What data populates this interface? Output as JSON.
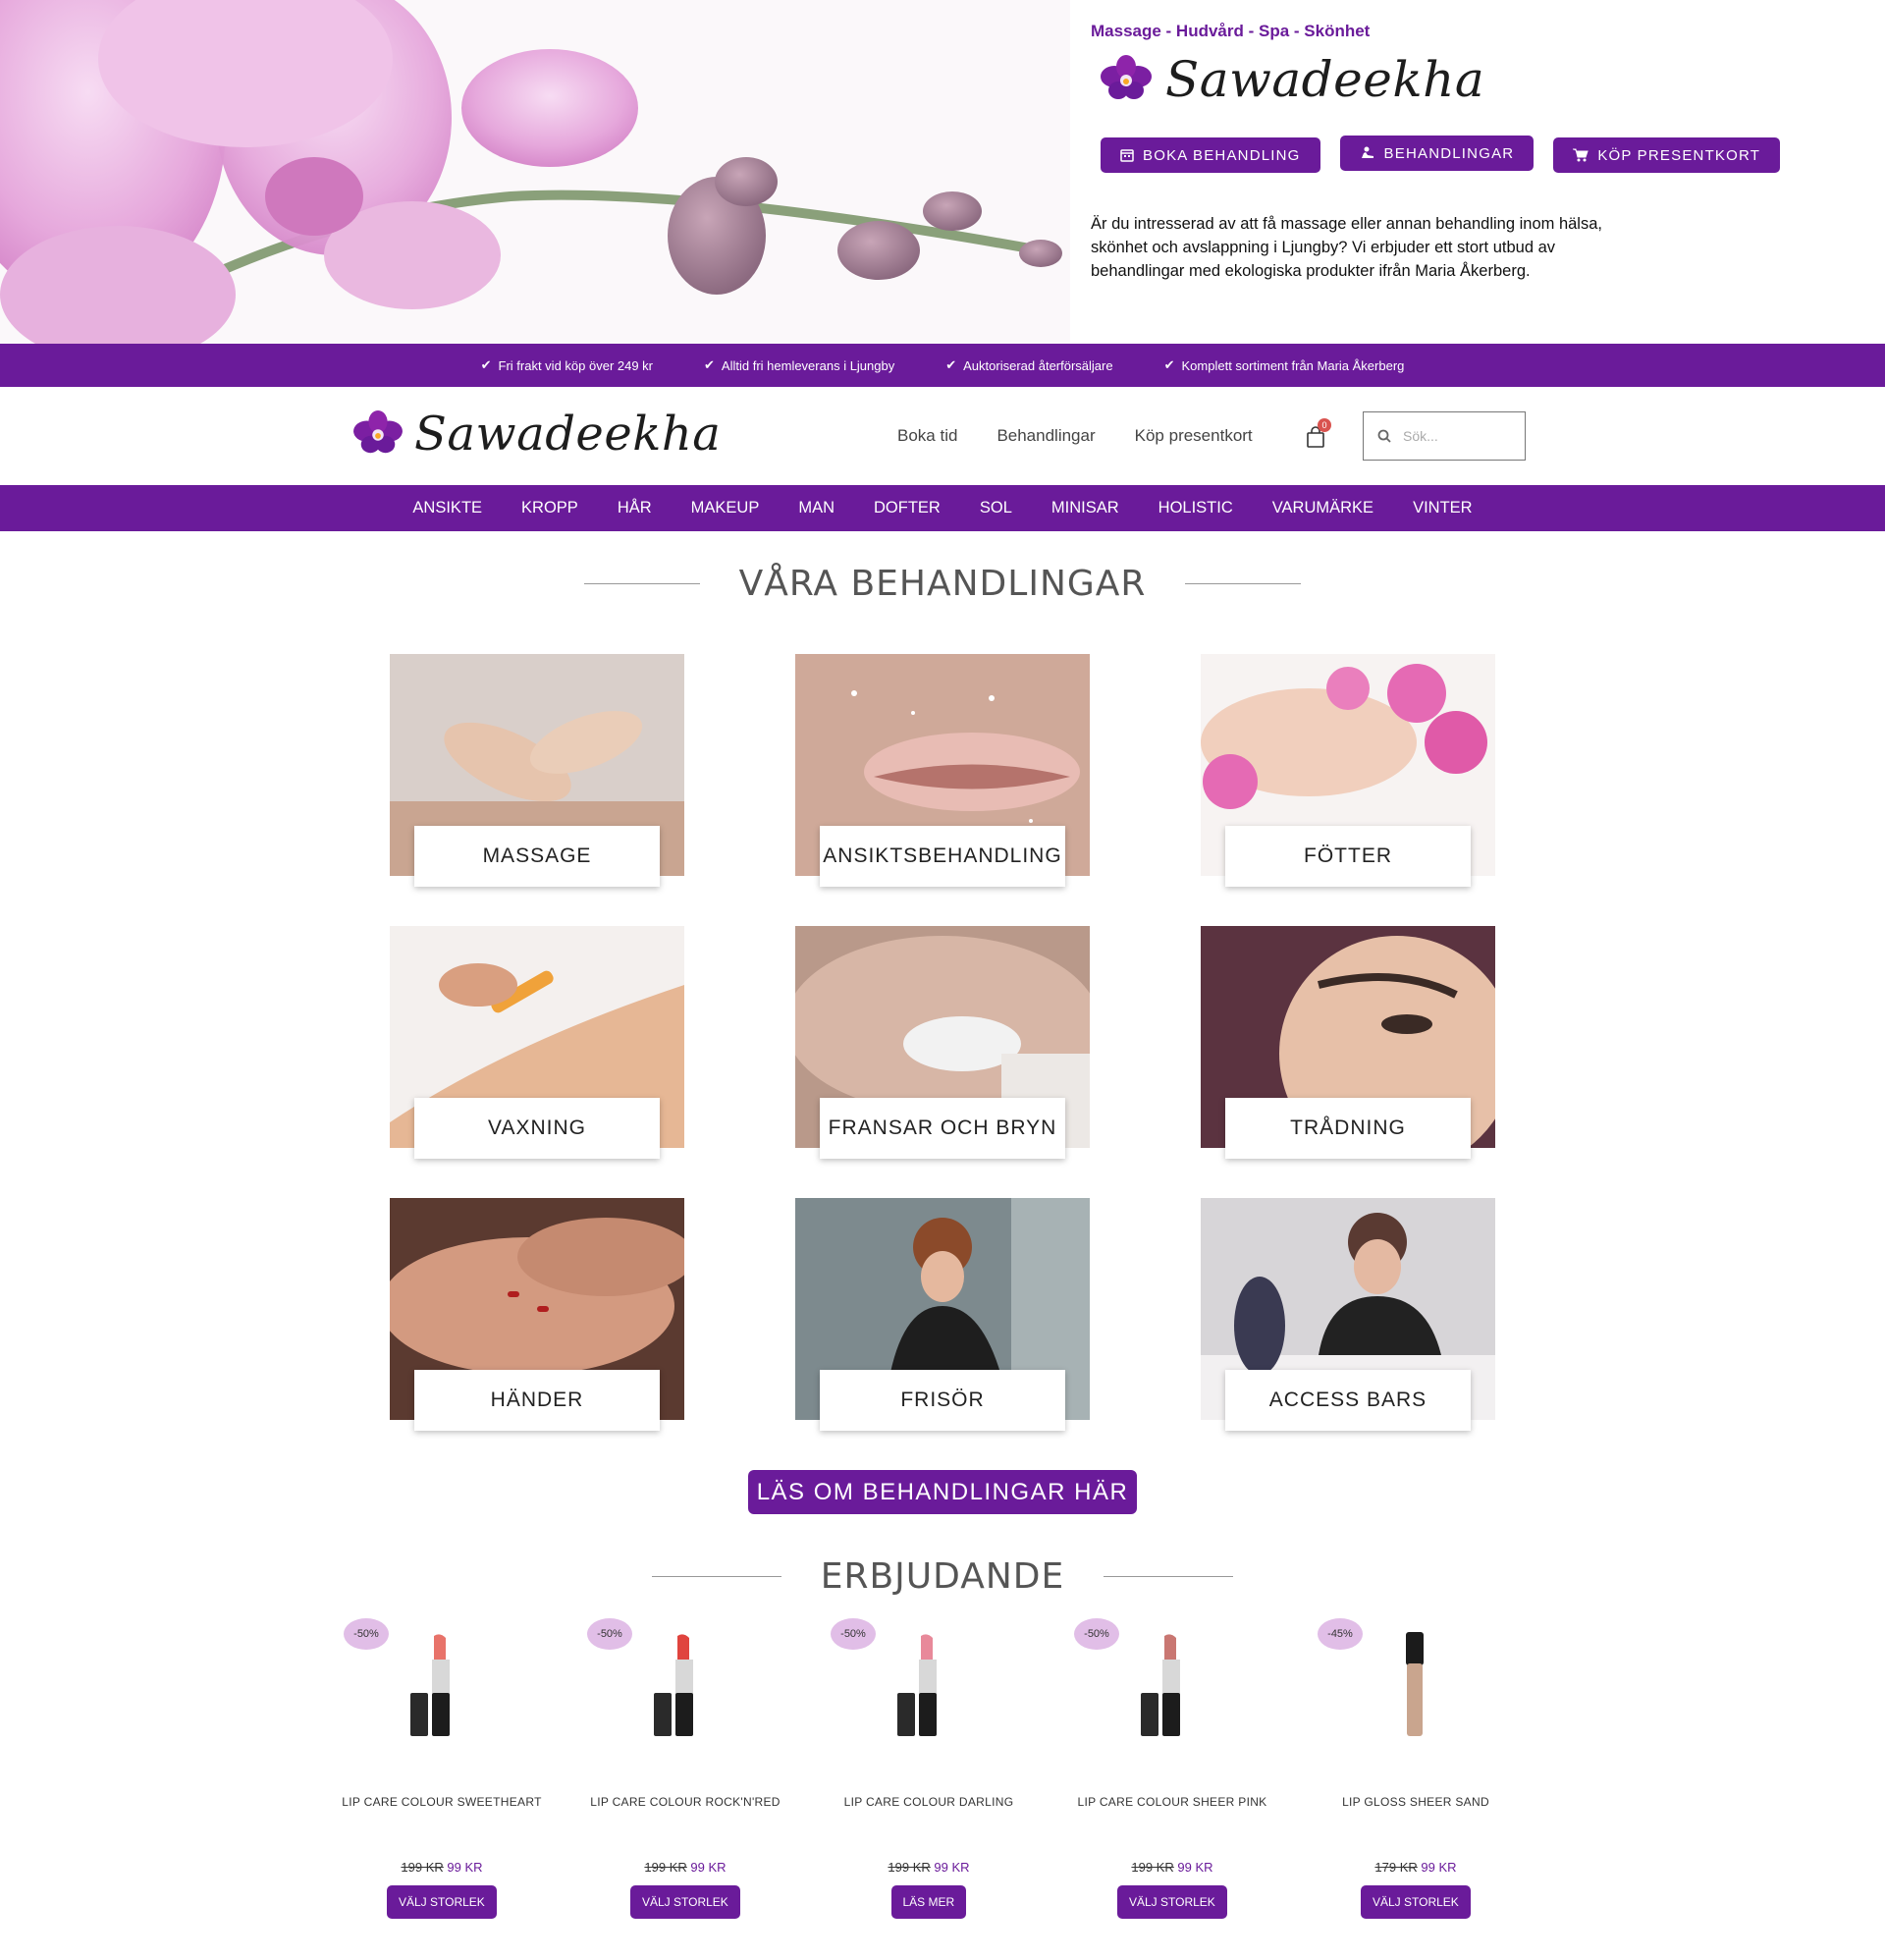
{
  "hero": {
    "tagline": "Massage - Hudvård - Spa - Skönhet",
    "brand": "Sawadeekha",
    "buttons": [
      {
        "label": "BOKA BEHANDLING",
        "icon": "calendar-icon"
      },
      {
        "label": "BEHANDLINGAR",
        "icon": "massage-icon"
      },
      {
        "label": "KÖP PRESENTKORT",
        "icon": "cart-icon"
      }
    ],
    "intro": "Är du intresserad av att få massage eller annan behandling inom hälsa, skönhet och avslappning i Ljungby? Vi erbjuder ett stort utbud av behandlingar med ekologiska produkter ifrån Maria Åkerberg."
  },
  "usp": [
    "Fri frakt vid köp över 249 kr",
    "Alltid fri hemleverans i Ljungby",
    "Auktoriserad återförsäljare",
    "Komplett sortiment från Maria Åkerberg"
  ],
  "header": {
    "brand": "Sawadeekha",
    "nav": [
      "Boka tid",
      "Behandlingar",
      "Köp presentkort"
    ],
    "cart_count": "0",
    "search_placeholder": "Sök..."
  },
  "categories": [
    "ANSIKTE",
    "KROPP",
    "HÅR",
    "MAKEUP",
    "MAN",
    "DOFTER",
    "SOL",
    "MINISAR",
    "HOLISTIC",
    "VARUMÄRKE",
    "VINTER"
  ],
  "treatments": {
    "title": "VÅRA BEHANDLINGAR",
    "items": [
      "MASSAGE",
      "ANSIKTSBEHANDLING",
      "FÖTTER",
      "VAXNING",
      "FRANSAR OCH BRYN",
      "TRÅDNING",
      "HÄNDER",
      "FRISÖR",
      "ACCESS BARS"
    ],
    "cta": "LÄS OM BEHANDLINGAR HÄR"
  },
  "offers": {
    "title": "ERBJUDANDE",
    "products": [
      {
        "discount": "-50%",
        "name": "LIP CARE COLOUR SWEETHEART",
        "old_price": "199 KR",
        "new_price": "99 KR",
        "button": "VÄLJ STORLEK",
        "color": "#e8736a"
      },
      {
        "discount": "-50%",
        "name": "LIP CARE COLOUR ROCK'N'RED",
        "old_price": "199 KR",
        "new_price": "99 KR",
        "button": "VÄLJ STORLEK",
        "color": "#e0443e"
      },
      {
        "discount": "-50%",
        "name": "LIP CARE COLOUR DARLING",
        "old_price": "199 KR",
        "new_price": "99 KR",
        "button": "LÄS MER",
        "color": "#e8899a"
      },
      {
        "discount": "-50%",
        "name": "LIP CARE COLOUR SHEER PINK",
        "old_price": "199 KR",
        "new_price": "99 KR",
        "button": "VÄLJ STORLEK",
        "color": "#c97772"
      },
      {
        "discount": "-45%",
        "name": "LIP GLOSS SHEER SAND",
        "old_price": "179 KR",
        "new_price": "99 KR",
        "button": "VÄLJ STORLEK",
        "color": "#c9a58e"
      }
    ]
  },
  "colors": {
    "brand": "#6a1b9a",
    "badge": "#e1bee7"
  }
}
